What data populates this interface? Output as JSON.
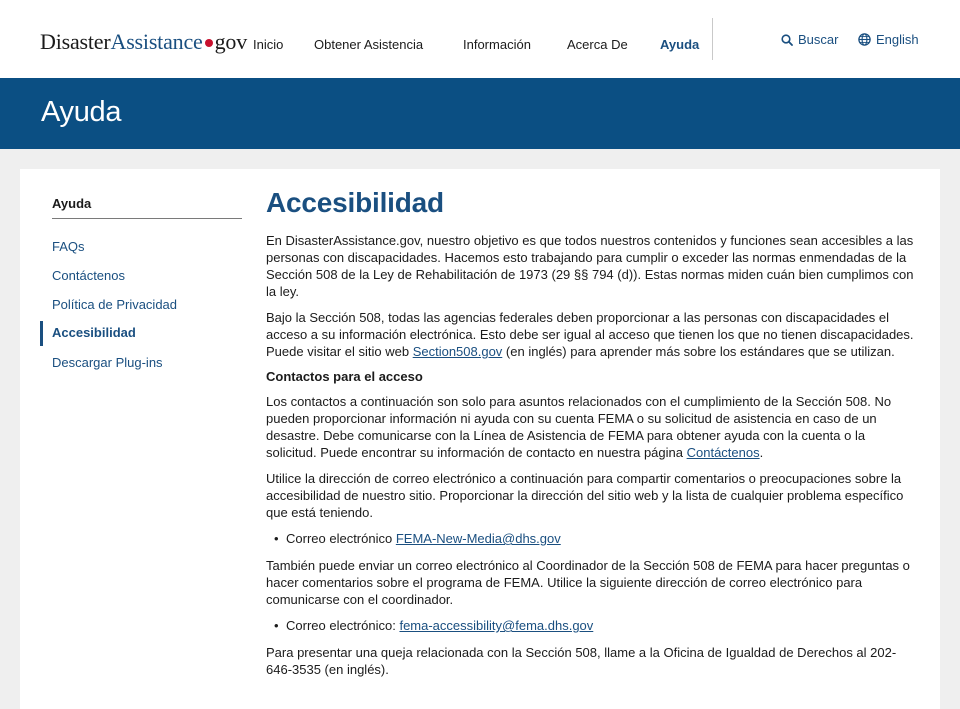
{
  "header": {
    "logo": {
      "part1": "Disaster",
      "part2": "Assistance",
      "part3": "gov"
    },
    "nav": [
      "Inicio",
      "Obtener Asistencia",
      "Información",
      "Acerca De",
      "Ayuda"
    ],
    "active_nav": "Ayuda",
    "search_label": "Buscar",
    "language_label": "English"
  },
  "banner": {
    "title": "Ayuda"
  },
  "sidebar": {
    "title": "Ayuda",
    "items": [
      "FAQs",
      "Contáctenos",
      "Política de Privacidad",
      "Accesibilidad",
      "Descargar Plug-ins"
    ],
    "active": "Accesibilidad"
  },
  "main": {
    "title": "Accesibilidad",
    "p1": "En DisasterAssistance.gov, nuestro objetivo es que todos nuestros contenidos y funciones sean accesibles a las personas con discapacidades. Hacemos esto trabajando para cumplir o exceder las normas enmendadas de la Sección 508 de la Ley de Rehabilitación de 1973 (29 §§ 794 (d)). Estas normas miden cuán bien cumplimos con la ley.",
    "p2_before": "Bajo la Sección 508, todas las agencias federales deben proporcionar a las personas con discapacidades el acceso a su información electrónica. Esto debe ser igual al acceso que tienen los que no tienen discapacidades. Puede visitar el sitio web ",
    "p2_link": "Section508.gov",
    "p2_after": " (en inglés) para aprender más sobre los estándares que se utilizan.",
    "subheading": "Contactos para el acceso",
    "p3_before": "Los contactos a continuación son solo para asuntos relacionados con el cumplimiento de la Sección 508. No pueden proporcionar información ni ayuda con su cuenta FEMA o su solicitud de asistencia en caso de un desastre. Debe comunicarse con la Línea de Asistencia de FEMA para obtener ayuda con la cuenta o la solicitud. Puede encontrar su información de contacto en nuestra página ",
    "p3_link": "Contáctenos",
    "p3_after": ".",
    "p4": "Utilice la dirección de correo electrónico a continuación para compartir comentarios o preocupaciones sobre la accesibilidad de nuestro sitio. Proporcionar la dirección del sitio web y la lista de cualquier problema específico que está teniendo.",
    "bullet1_label": "Correo electrónico ",
    "bullet1_link": "FEMA-New-Media@dhs.gov",
    "p5": "También puede enviar un correo electrónico al Coordinador de la Sección 508 de FEMA para hacer preguntas o hacer comentarios sobre el programa de FEMA. Utilice la siguiente dirección de correo electrónico para comunicarse con el coordinador.",
    "bullet2_label": "Correo electrónico: ",
    "bullet2_link": "fema-accessibility@fema.dhs.gov",
    "p6": "Para presentar una queja relacionada con la Sección 508, llame a la Oficina de Igualdad de Derechos al 202-646-3535 (en inglés)."
  },
  "colors": {
    "brand_blue": "#0b4f83",
    "link_blue": "#1a4f80",
    "logo_dot": "#c8102e"
  },
  "icons": {
    "search": "search-icon",
    "language": "globe-icon"
  }
}
